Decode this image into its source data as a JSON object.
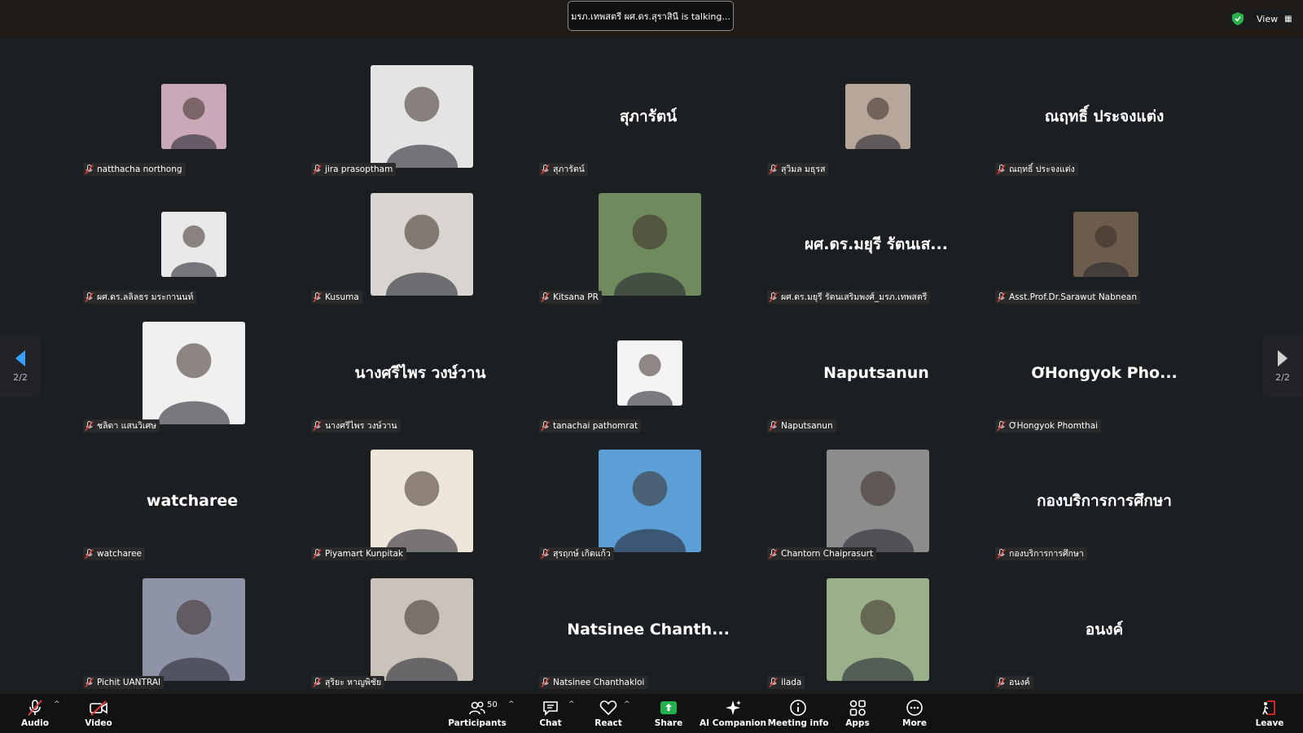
{
  "top": {
    "talking": "มรภ.เทพสตรี ผศ.ดร.สุราสินี is talking...",
    "view_label": "View"
  },
  "pager": {
    "page": "2/2"
  },
  "participants": [
    {
      "name": "natthacha northong",
      "display": "photo",
      "size": "small",
      "bg": "#c9a8b8"
    },
    {
      "name": "jira prasoptham",
      "display": "photo",
      "size": "large",
      "bg": "#e4e4e4"
    },
    {
      "name": "สุภารัตน์",
      "display": "text",
      "text": "สุภารัตน์"
    },
    {
      "name": "สุวิมล มธุรส",
      "display": "photo",
      "size": "small",
      "bg": "#b7a69a"
    },
    {
      "name": "ณฤทธิ์ ประจงแต่ง",
      "display": "text",
      "text": "ณฤทธิ์ ประจงแต่ง"
    },
    {
      "name": "ผศ.ดร.ลลิลธร มระกานนท์",
      "display": "photo",
      "size": "small",
      "bg": "#e8e8e8"
    },
    {
      "name": "Kusuma",
      "display": "photo",
      "size": "large",
      "bg": "#d8d4cf"
    },
    {
      "name": "Kitsana PR",
      "display": "photo",
      "size": "large",
      "bg": "#6f8a5c"
    },
    {
      "name": "ผศ.ดร.มยุรี รัตนเสริมพงศ์_มรภ.เทพสตรี",
      "display": "text",
      "text": "ผศ.ดร.มยุรี รัตนเส..."
    },
    {
      "name": "Asst.Prof.Dr.Sarawut Nabnean",
      "display": "photo",
      "size": "small",
      "bg": "#6c5c4c"
    },
    {
      "name": "ชลิดา แสนวิเศษ",
      "display": "photo",
      "size": "large",
      "bg": "#f0f0f0"
    },
    {
      "name": "นางศรีไพร  วงษ์วาน",
      "display": "text",
      "text": "นางศรีไพร  วงษ์วาน"
    },
    {
      "name": "tanachai pathomrat",
      "display": "photo",
      "size": "small",
      "bg": "#f4f4f4"
    },
    {
      "name": "Naputsanun",
      "display": "text",
      "text": "Naputsanun"
    },
    {
      "name": "ƠHongyok Phomthai",
      "display": "text",
      "text": "ƠHongyok  Pho..."
    },
    {
      "name": "watcharee",
      "display": "text",
      "text": "watcharee"
    },
    {
      "name": "Piyamart Kunpitak",
      "display": "photo",
      "size": "large",
      "bg": "#efe6da"
    },
    {
      "name": "สุรฤกษ์ เกิดแก้ว",
      "display": "photo",
      "size": "large",
      "bg": "#5b9fd6"
    },
    {
      "name": "Chantorn Chaiprasurt",
      "display": "photo",
      "size": "large",
      "bg": "#8c8c8c"
    },
    {
      "name": "กองบริการการศึกษา",
      "display": "text",
      "text": "กองบริการการศึกษา"
    },
    {
      "name": "Pichit UANTRAI",
      "display": "photo",
      "size": "large",
      "bg": "#8f93a8"
    },
    {
      "name": "สุริยะ หาญพิชัย",
      "display": "photo",
      "size": "large",
      "bg": "#c9c3ba"
    },
    {
      "name": "Natsinee Chanthakloi",
      "display": "text",
      "text": "Natsinee  Chanth..."
    },
    {
      "name": "ilada",
      "display": "photo",
      "size": "large",
      "bg": "#9ab08a"
    },
    {
      "name": "อนงค์",
      "display": "text",
      "text": "อนงค์"
    }
  ],
  "toolbar": {
    "audio": "Audio",
    "video": "Video",
    "participants": "Participants",
    "participants_count": "50",
    "chat": "Chat",
    "react": "React",
    "share": "Share",
    "ai": "AI Companion",
    "meeting_info": "Meeting info",
    "apps": "Apps",
    "more": "More",
    "leave": "Leave"
  },
  "colors": {
    "share_green": "#22b14c",
    "leave_red": "#e02828",
    "muted_red": "#e04040"
  }
}
